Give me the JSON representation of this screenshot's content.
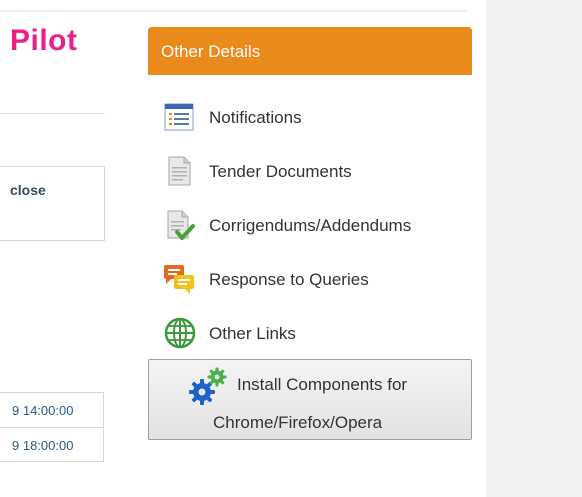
{
  "page": {
    "title": "Pilot"
  },
  "left_table": {
    "header_cell": "close",
    "dates": [
      "9 14:00:00",
      "9 18:00:00"
    ]
  },
  "panel": {
    "header": "Other Details",
    "items": [
      {
        "label": "Notifications",
        "icon": "notifications-list-icon"
      },
      {
        "label": "Tender Documents",
        "icon": "document-icon"
      },
      {
        "label": "Corrigendums/Addendums",
        "icon": "document-check-icon"
      },
      {
        "label": "Response to Queries",
        "icon": "chat-bubbles-icon"
      },
      {
        "label": "Other Links",
        "icon": "globe-icon"
      }
    ],
    "install_button": {
      "line1": "Install Components for",
      "line2": "Chrome/Firefox/Opera",
      "icon": "gears-icon"
    }
  },
  "colors": {
    "title": "#ec1e8c",
    "panel_header": "#ea8a1b",
    "link": "#2c5a87"
  }
}
